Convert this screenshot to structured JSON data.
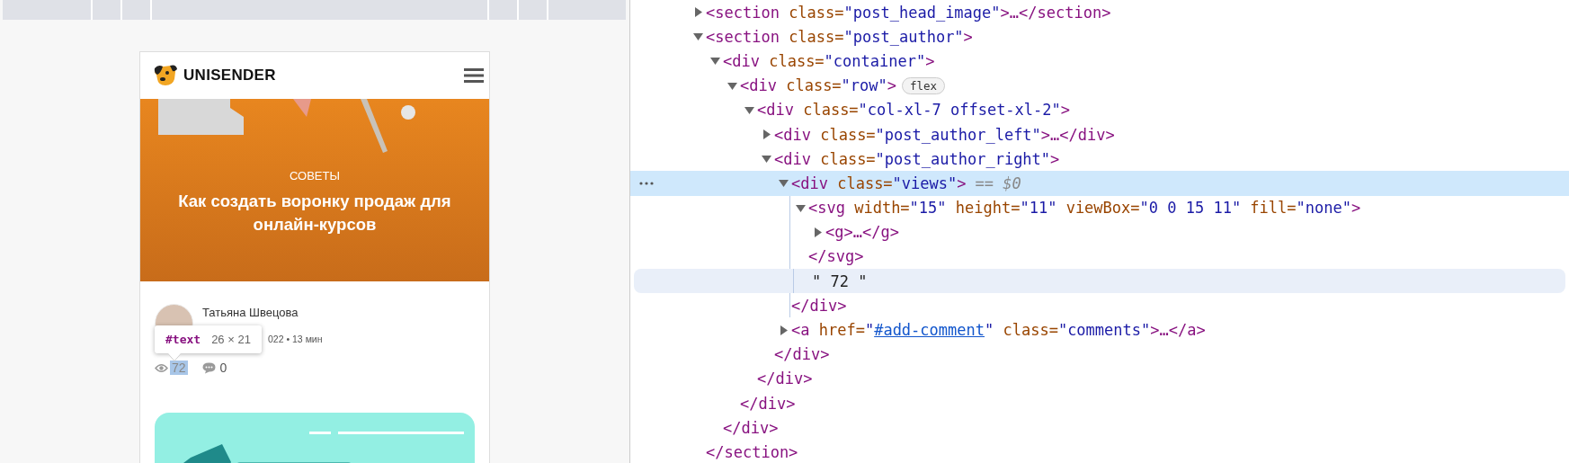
{
  "page_preview": {
    "logo": "UNISENDER",
    "hero": {
      "category": "СОВЕТЫ",
      "title": "Как создать воронку продаж для онлайн-курсов"
    },
    "author": {
      "name": "Татьяна Швецова",
      "meta": "022 • 13 мин"
    },
    "views": "72",
    "views_highlighted": true,
    "comments": "0"
  },
  "inspect_tooltip": {
    "node": "#text",
    "size": "26 × 21"
  },
  "elements_tree": [
    {
      "kind": "element",
      "expanded": false,
      "selected": false,
      "hovered": false,
      "parts": [
        {
          "kind": "tag",
          "text": "<section"
        },
        {
          "kind": "attr",
          "text": " class="
        },
        {
          "kind": "value",
          "text": "\"post_head_image\""
        },
        {
          "kind": "tag",
          "text": ">…</section>"
        }
      ]
    },
    {
      "kind": "element",
      "expanded": true,
      "selected": false,
      "hovered": false,
      "parts": [
        {
          "kind": "tag",
          "text": "<section"
        },
        {
          "kind": "attr",
          "text": " class="
        },
        {
          "kind": "value",
          "text": "\"post_author\""
        },
        {
          "kind": "tag",
          "text": ">"
        }
      ],
      "closing": "</section>",
      "children": [
        {
          "kind": "element",
          "expanded": true,
          "selected": false,
          "hovered": false,
          "parts": [
            {
              "kind": "tag",
              "text": "<div"
            },
            {
              "kind": "attr",
              "text": " class="
            },
            {
              "kind": "value",
              "text": "\"container\""
            },
            {
              "kind": "tag",
              "text": ">"
            }
          ],
          "closing": "</div>",
          "children": [
            {
              "kind": "element",
              "expanded": true,
              "selected": false,
              "hovered": false,
              "parts": [
                {
                  "kind": "tag",
                  "text": "<div"
                },
                {
                  "kind": "attr",
                  "text": " class="
                },
                {
                  "kind": "value",
                  "text": "\"row\""
                },
                {
                  "kind": "tag",
                  "text": ">"
                },
                {
                  "kind": "badge",
                  "text": "flex"
                }
              ],
              "closing": "</div>",
              "children": [
                {
                  "kind": "element",
                  "expanded": true,
                  "selected": false,
                  "hovered": false,
                  "parts": [
                    {
                      "kind": "tag",
                      "text": "<div"
                    },
                    {
                      "kind": "attr",
                      "text": " class="
                    },
                    {
                      "kind": "value",
                      "text": "\"col-xl-7 offset-xl-2\""
                    },
                    {
                      "kind": "tag",
                      "text": ">"
                    }
                  ],
                  "closing": "</div>",
                  "children": [
                    {
                      "kind": "element",
                      "expanded": false,
                      "selected": false,
                      "hovered": false,
                      "parts": [
                        {
                          "kind": "tag",
                          "text": "<div"
                        },
                        {
                          "kind": "attr",
                          "text": " class="
                        },
                        {
                          "kind": "value",
                          "text": "\"post_author_left\""
                        },
                        {
                          "kind": "tag",
                          "text": ">…</div>"
                        }
                      ]
                    },
                    {
                      "kind": "element",
                      "expanded": true,
                      "selected": false,
                      "hovered": false,
                      "parts": [
                        {
                          "kind": "tag",
                          "text": "<div"
                        },
                        {
                          "kind": "attr",
                          "text": " class="
                        },
                        {
                          "kind": "value",
                          "text": "\"post_author_right\""
                        },
                        {
                          "kind": "tag",
                          "text": ">"
                        }
                      ],
                      "closing": "</div>",
                      "children": [
                        {
                          "kind": "element",
                          "expanded": true,
                          "selected": true,
                          "hovered": false,
                          "parts": [
                            {
                              "kind": "tag",
                              "text": "<div"
                            },
                            {
                              "kind": "attr",
                              "text": " class="
                            },
                            {
                              "kind": "value",
                              "text": "\"views\""
                            },
                            {
                              "kind": "tag",
                              "text": ">"
                            },
                            {
                              "kind": "suffix",
                              "text": "== $0"
                            }
                          ],
                          "closing": "</div>",
                          "children": [
                            {
                              "kind": "element",
                              "expanded": true,
                              "selected": false,
                              "hovered": false,
                              "parts": [
                                {
                                  "kind": "tag",
                                  "text": "<svg"
                                },
                                {
                                  "kind": "attr",
                                  "text": " width="
                                },
                                {
                                  "kind": "value",
                                  "text": "\"15\""
                                },
                                {
                                  "kind": "attr",
                                  "text": " height="
                                },
                                {
                                  "kind": "value",
                                  "text": "\"11\""
                                },
                                {
                                  "kind": "attr",
                                  "text": " viewBox="
                                },
                                {
                                  "kind": "value",
                                  "text": "\"0 0 15 11\""
                                },
                                {
                                  "kind": "attr",
                                  "text": " fill="
                                },
                                {
                                  "kind": "value",
                                  "text": "\"none\""
                                },
                                {
                                  "kind": "tag",
                                  "text": ">"
                                }
                              ],
                              "closing": "</svg>",
                              "children": [
                                {
                                  "kind": "element",
                                  "expanded": false,
                                  "selected": false,
                                  "hovered": false,
                                  "parts": [
                                    {
                                      "kind": "tag",
                                      "text": "<g>…</g>"
                                    }
                                  ]
                                }
                              ]
                            },
                            {
                              "kind": "text",
                              "selected": false,
                              "hovered": true,
                              "parts": [
                                {
                                  "kind": "text",
                                  "text": "\" 72 \""
                                }
                              ]
                            }
                          ]
                        },
                        {
                          "kind": "element",
                          "expanded": false,
                          "selected": false,
                          "hovered": false,
                          "parts": [
                            {
                              "kind": "tag",
                              "text": "<a"
                            },
                            {
                              "kind": "attr",
                              "text": " href="
                            },
                            {
                              "kind": "value",
                              "text": "\""
                            },
                            {
                              "kind": "link",
                              "text": "#add-comment"
                            },
                            {
                              "kind": "value",
                              "text": "\""
                            },
                            {
                              "kind": "attr",
                              "text": " class="
                            },
                            {
                              "kind": "value",
                              "text": "\"comments\""
                            },
                            {
                              "kind": "tag",
                              "text": ">…</a>"
                            }
                          ]
                        }
                      ]
                    }
                  ]
                }
              ]
            }
          ]
        }
      ]
    }
  ]
}
